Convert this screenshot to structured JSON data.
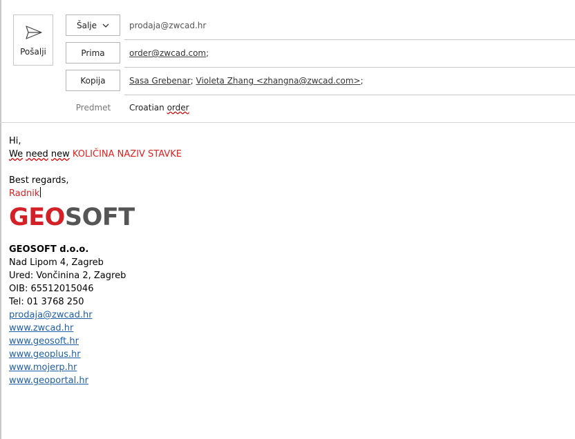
{
  "header": {
    "send_label": "Pošalji",
    "from_button": "Šalje",
    "from_value": "prodaja@zwcad.hr",
    "to_button": "Prima",
    "to_value": "order@zwcad.com",
    "cc_button": "Kopija",
    "cc_recipients": [
      "Sasa Grebenar",
      "Violeta Zhang <zhangna@zwcad.com>"
    ],
    "subject_label": "Predmet",
    "subject_word1": "Croatian",
    "subject_word2": "order"
  },
  "body": {
    "greeting": "Hi,",
    "line2_prefix1": "We",
    "line2_prefix2": "need",
    "line2_prefix3": "new",
    "line2_red": "KOLIČINA NAZIV STAVKE",
    "closing": "Best regards,",
    "signer": "Radnik"
  },
  "signature": {
    "logo_part1": "GEO",
    "logo_part2": "SOFT",
    "company": "GEOSOFT d.o.o.",
    "address": "Nad Lipom 4, Zagreb",
    "office": "Ured: Vončinina 2, Zagreb",
    "oib": "OIB: 65512015046",
    "tel": "Tel: 01 3768 250",
    "links": [
      "prodaja@zwcad.hr",
      "www.zwcad.hr",
      "www.geosoft.hr",
      "www.geoplus.hr",
      "www.mojerp.hr",
      "www.geoportal.hr"
    ]
  },
  "colors": {
    "accent_red": "#e02020",
    "logo_red": "#d42027",
    "logo_gray": "#555555",
    "link_blue": "#1f5fa8"
  },
  "icons": {
    "send": "send-icon",
    "from_dropdown": "chevron-down-icon"
  }
}
